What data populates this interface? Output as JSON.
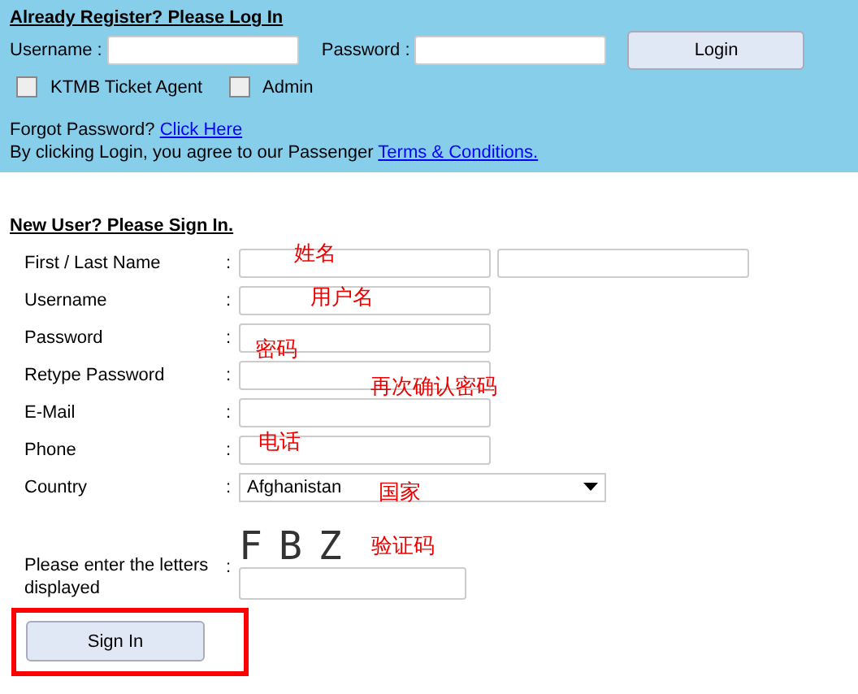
{
  "login": {
    "heading": "Already Register? Please Log In",
    "username_label": "Username :",
    "password_label": "Password :",
    "button": "Login",
    "roles": [
      {
        "label": "KTMB Ticket Agent",
        "checked": false
      },
      {
        "label": "Admin",
        "checked": false
      }
    ],
    "forgot_text": "Forgot Password?",
    "forgot_link": "Click Here",
    "agree_text": "By clicking Login, you agree to our Passenger",
    "agree_link": "Terms & Conditions."
  },
  "signup": {
    "heading": "New User? Please Sign In.",
    "fields": [
      {
        "label": "First / Last Name",
        "separator": ":",
        "kind": "name",
        "annotation": "姓名"
      },
      {
        "label": "Username",
        "separator": ":",
        "kind": "text",
        "annotation": "用户名"
      },
      {
        "label": "Password",
        "separator": ":",
        "kind": "text",
        "annotation": "密码"
      },
      {
        "label": "Retype Password",
        "separator": ":",
        "kind": "text",
        "annotation": "再次确认密码"
      },
      {
        "label": "E-Mail",
        "separator": ":",
        "kind": "text"
      },
      {
        "label": "Phone",
        "separator": ":",
        "kind": "text",
        "annotation": "电话"
      },
      {
        "label": "Country",
        "separator": ":",
        "kind": "select",
        "value": "Afghanistan",
        "annotation": "国家"
      }
    ],
    "captcha_label": "Please enter the letters displayed",
    "captcha_separator": ":",
    "captcha_letters": "FBZ",
    "captcha_annotation": "验证码",
    "button": "Sign In",
    "button_highlighted": true
  }
}
